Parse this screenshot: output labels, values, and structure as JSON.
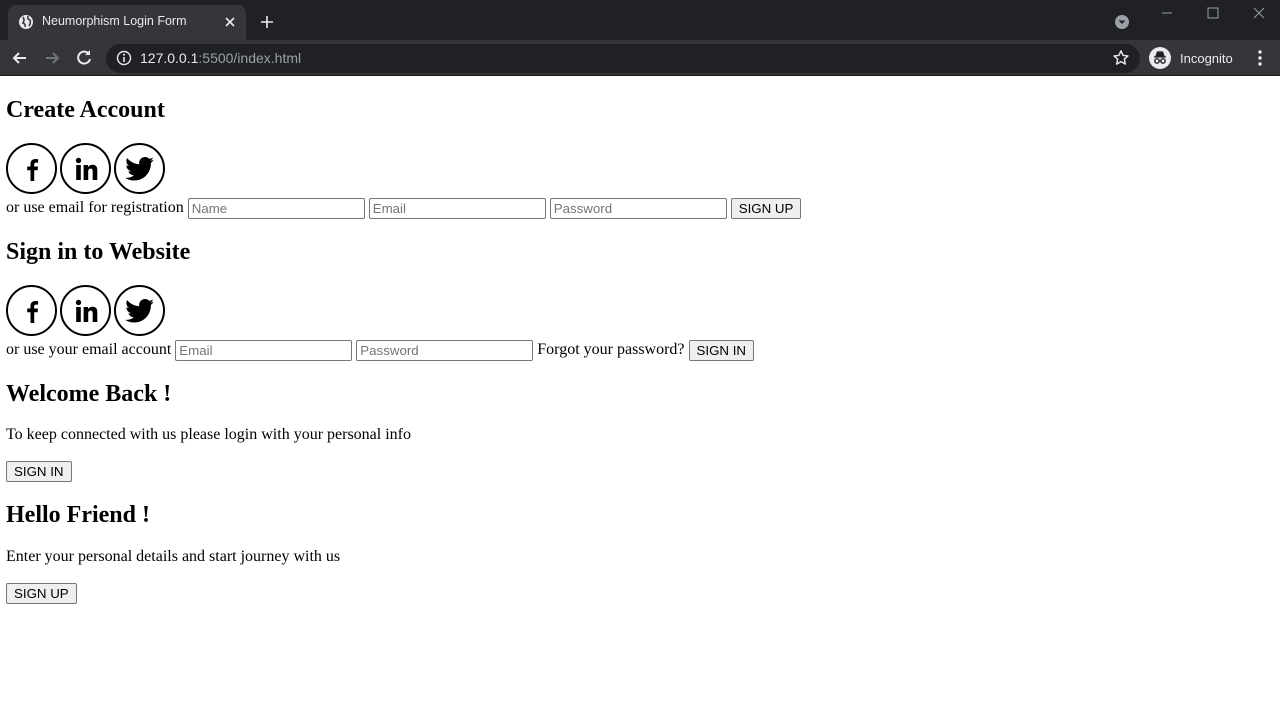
{
  "browser": {
    "tab_title": "Neumorphism Login Form",
    "url_host": "127.0.0.1",
    "url_rest": ":5500/index.html",
    "profile_label": "Incognito",
    "colors": {
      "tabbar": "#202124",
      "toolbar": "#35363a",
      "omnibox": "#202124"
    }
  },
  "create_account": {
    "heading": "Create Account",
    "social": [
      "facebook-icon",
      "linkedin-icon",
      "twitter-icon"
    ],
    "hint": "or use email for registration",
    "name_placeholder": "Name",
    "email_placeholder": "Email",
    "password_placeholder": "Password",
    "submit_label": "SIGN UP"
  },
  "sign_in": {
    "heading": "Sign in to Website",
    "social": [
      "facebook-icon",
      "linkedin-icon",
      "twitter-icon"
    ],
    "hint": "or use your email account",
    "email_placeholder": "Email",
    "password_placeholder": "Password",
    "forgot_text": "Forgot your password?",
    "submit_label": "SIGN IN"
  },
  "welcome_panel": {
    "heading": "Welcome Back !",
    "text": "To keep connected with us please login with your personal info",
    "button_label": "SIGN IN"
  },
  "hello_panel": {
    "heading": "Hello Friend !",
    "text": "Enter your personal details and start journey with us",
    "button_label": "SIGN UP"
  }
}
